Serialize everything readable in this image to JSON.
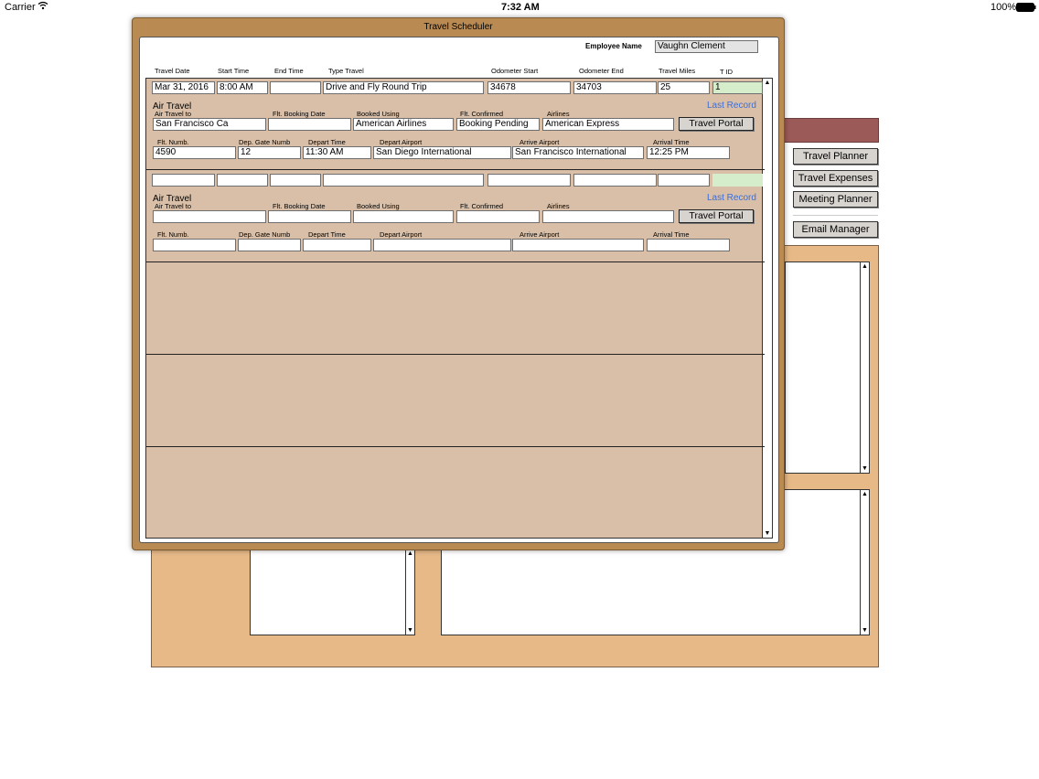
{
  "status_bar": {
    "carrier": "Carrier",
    "time": "7:32 AM",
    "battery": "100%"
  },
  "side_nav": {
    "items": [
      {
        "label": "Travel Planner"
      },
      {
        "label": "Travel Expenses"
      },
      {
        "label": "Meeting Planner"
      },
      {
        "label": "Email Manager"
      }
    ]
  },
  "dialog": {
    "title": "Travel Scheduler",
    "employee_label": "Employee Name",
    "employee_value": "Vaughn Clement",
    "columns": [
      "Travel Date",
      "Start Time",
      "End Time",
      "Type Travel",
      "Odometer Start",
      "Odometer End",
      "Travel Miles",
      "T ID"
    ],
    "records": [
      {
        "travel_date": "Mar 31, 2016",
        "start_time": "8:00 AM",
        "end_time": "",
        "type_travel": "Drive and Fly Round Trip",
        "odometer_start": "34678",
        "odometer_end": "34703",
        "travel_miles": "25",
        "t_id": "1",
        "section_title": "Air Travel",
        "last_record": "Last Record",
        "labels": {
          "air_travel_to": "Air Travel to",
          "flt_booking_date": "Flt. Booking Date",
          "booked_using": "Booked Using",
          "flt_confirmed": "Flt. Confirmed",
          "airlines": "Airlines",
          "flt_numb": "Flt. Numb.",
          "dep_gate_numb": "Dep. Gate Numb",
          "depart_time": "Depart Time",
          "depart_airport": "Depart Airport",
          "arrive_airport": "Arrive Airport",
          "arrival_time": "Arrival Time"
        },
        "air_travel_to": "San Francisco Ca",
        "flt_booking_date": "",
        "booked_using": "American Airlines",
        "flt_confirmed": "Booking Pending",
        "airlines": "American Express",
        "portal_button": "Travel Portal",
        "flt_numb": "4590",
        "dep_gate_numb": "12",
        "depart_time": "11:30 AM",
        "depart_airport": "San Diego International",
        "arrive_airport": "San Francisco International",
        "arrival_time": "12:25 PM"
      },
      {
        "travel_date": "",
        "start_time": "",
        "end_time": "",
        "type_travel": "",
        "odometer_start": "",
        "odometer_end": "",
        "travel_miles": "",
        "t_id": "",
        "section_title": "Air Travel",
        "last_record": "Last Record",
        "labels": {
          "air_travel_to": "Air Travel to",
          "flt_booking_date": "Flt. Booking Date",
          "booked_using": "Booked Using",
          "flt_confirmed": "Flt. Confirmed",
          "airlines": "Airlines",
          "flt_numb": "Flt. Numb.",
          "dep_gate_numb": "Dep. Gate Numb",
          "depart_time": "Depart Time",
          "depart_airport": "Depart Airport",
          "arrive_airport": "Arrive Airport",
          "arrival_time": "Arrival Time"
        },
        "air_travel_to": "",
        "flt_booking_date": "",
        "booked_using": "",
        "flt_confirmed": "",
        "airlines": "",
        "portal_button": "Travel Portal",
        "flt_numb": "",
        "dep_gate_numb": "",
        "depart_time": "",
        "depart_airport": "",
        "arrive_airport": "",
        "arrival_time": ""
      }
    ]
  },
  "icons": {
    "wifi": "wifi-icon",
    "battery": "battery-icon",
    "scroll_up": "arrow-up-icon",
    "scroll_down": "arrow-down-icon"
  }
}
